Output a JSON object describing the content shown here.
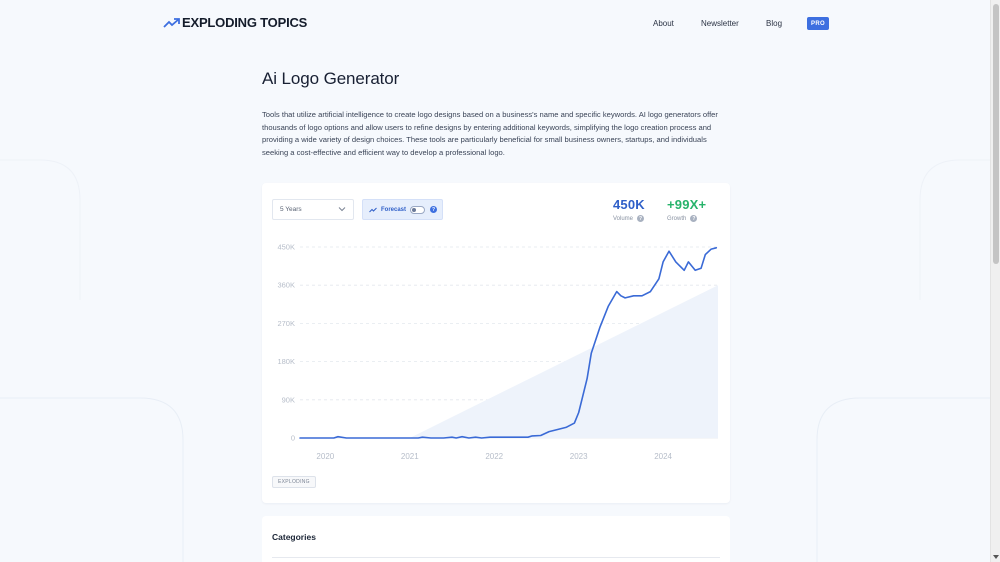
{
  "header": {
    "logo_text": "EXPLODING TOPICS",
    "nav": [
      {
        "label": "About"
      },
      {
        "label": "Newsletter"
      },
      {
        "label": "Blog"
      }
    ],
    "pro_label": "PRO"
  },
  "page": {
    "title": "Ai Logo Generator",
    "description": "Tools that utilize artificial intelligence to create logo designs based on a business's name and specific keywords. AI logo generators offer thousands of logo options and allow users to refine designs by entering additional keywords, simplifying the logo creation process and providing a wide variety of design choices. These tools are particularly beneficial for small business owners, startups, and individuals seeking a cost-effective and efficient way to develop a professional logo."
  },
  "controls": {
    "range_selected": "5 Years",
    "forecast_label": "Forecast",
    "forecast_on": false
  },
  "metrics": {
    "volume_value": "450K",
    "volume_label": "Volume",
    "growth_value": "+99X+",
    "growth_label": "Growth"
  },
  "colors": {
    "accent": "#3d6fe0",
    "line": "#3a6ad6",
    "volume": "#2f5fc8",
    "growth": "#27b36b"
  },
  "chart_data": {
    "type": "line",
    "xlabel": "",
    "ylabel": "",
    "x_ticks": [
      "2020",
      "2021",
      "2022",
      "2023",
      "2024"
    ],
    "y_ticks": [
      "450K",
      "360K",
      "270K",
      "180K",
      "90K",
      "0"
    ],
    "ylim": [
      0,
      450000
    ],
    "xlim": [
      2019.7,
      2024.65
    ],
    "series": [
      {
        "x": [
          2019.7,
          2019.9,
          2020.1,
          2020.15,
          2020.25,
          2020.5,
          2020.8,
          2021.0,
          2021.1,
          2021.15,
          2021.25,
          2021.4,
          2021.5,
          2021.55,
          2021.62,
          2021.7,
          2021.78,
          2021.85,
          2021.95,
          2022.1,
          2022.25,
          2022.4,
          2022.45,
          2022.55,
          2022.65,
          2022.75,
          2022.85,
          2022.95,
          2023.0,
          2023.05,
          2023.1,
          2023.15,
          2023.25,
          2023.35,
          2023.45,
          2023.5,
          2023.55,
          2023.65,
          2023.75,
          2023.85,
          2023.95,
          2024.0,
          2024.07,
          2024.15,
          2024.25,
          2024.3,
          2024.38,
          2024.45,
          2024.5,
          2024.57,
          2024.63
        ],
        "y": [
          0,
          0,
          0,
          3000,
          0,
          0,
          0,
          0,
          0,
          2000,
          0,
          0,
          2000,
          0,
          3000,
          0,
          2000,
          0,
          2000,
          2000,
          2000,
          2000,
          5000,
          6000,
          15000,
          20000,
          25000,
          35000,
          60000,
          100000,
          140000,
          200000,
          260000,
          310000,
          345000,
          335000,
          330000,
          335000,
          335000,
          345000,
          375000,
          415000,
          440000,
          415000,
          395000,
          415000,
          395000,
          400000,
          432000,
          445000,
          448000
        ]
      }
    ],
    "forecast_area": {
      "x": [
        2021.0,
        2024.65
      ],
      "y": [
        0,
        360000
      ]
    },
    "grid": "horizontal-dashed",
    "badge": "EXPLODING"
  },
  "categories": {
    "title": "Categories"
  }
}
